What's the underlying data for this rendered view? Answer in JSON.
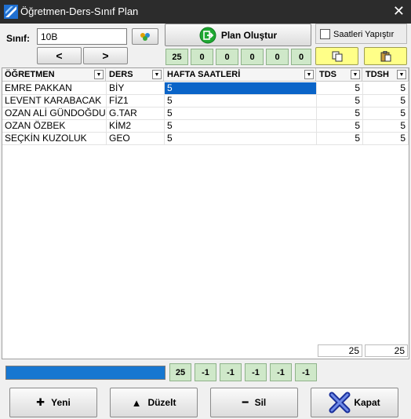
{
  "window": {
    "title": "Öğretmen-Ders-Sınıf Plan",
    "close_glyph": "✕"
  },
  "form": {
    "sinif_label": "Sınıf:",
    "sinif_value": "10B",
    "prev_label": "<",
    "next_label": ">",
    "plan_button_label": "Plan Oluştur",
    "checkbox_label": "Saatleri Yapıştır",
    "checkbox_checked": false,
    "top_counters": [
      "25",
      "0",
      "0",
      "0",
      "0",
      "0"
    ]
  },
  "grid": {
    "columns": [
      "ÖĞRETMEN",
      "DERS",
      "HAFTA SAATLERİ",
      "TDS",
      "TDSH"
    ],
    "rows": [
      {
        "ogretmen": "EMRE PAKKAN",
        "ders": "BİY",
        "hafta": "5",
        "tds": "5",
        "tdsh": "5"
      },
      {
        "ogretmen": "LEVENT KARABACAK",
        "ders": "FİZ1",
        "hafta": "5",
        "tds": "5",
        "tdsh": "5"
      },
      {
        "ogretmen": "OZAN ALİ GÜNDOĞDU",
        "ders": "G.TAR",
        "hafta": "5",
        "tds": "5",
        "tdsh": "5"
      },
      {
        "ogretmen": "OZAN ÖZBEK",
        "ders": "KİM2",
        "hafta": "5",
        "tds": "5",
        "tdsh": "5"
      },
      {
        "ogretmen": "SEÇKİN KUZOLUK",
        "ders": "GEO",
        "hafta": "5",
        "tds": "5",
        "tdsh": "5"
      }
    ],
    "footer_tds": "25",
    "footer_tdsh": "25"
  },
  "progress": {
    "fraction": 1.0
  },
  "bottom_counters": [
    "25",
    "-1",
    "-1",
    "-1",
    "-1",
    "-1"
  ],
  "buttons": {
    "yeni": "Yeni",
    "duzelt": "Düzelt",
    "sil": "Sil",
    "kapat": "Kapat"
  },
  "colors": {
    "titlebar": "#2c2c2c",
    "selection": "#0a64c8",
    "counter_bg": "#cfe8c9",
    "paste_button_bg": "#ffff88",
    "progress_fill": "#1777d1",
    "plan_icon_green": "#1ea832"
  }
}
